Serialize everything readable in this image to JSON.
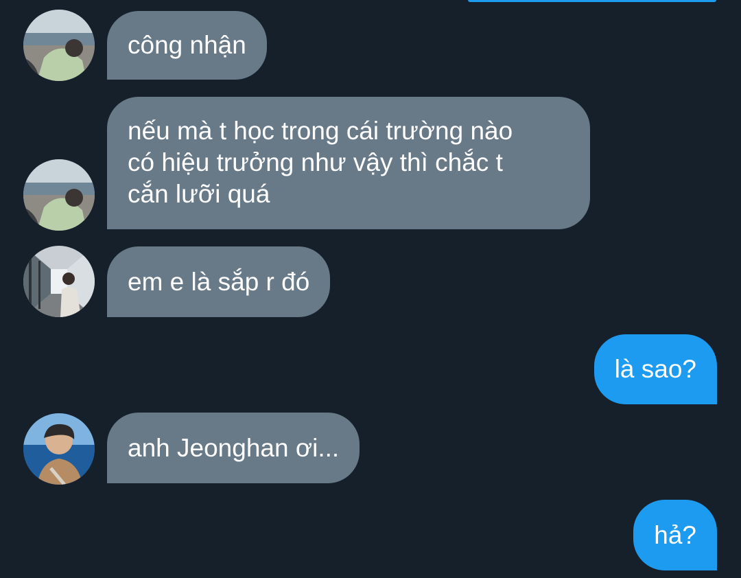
{
  "conversation": {
    "messages": [
      {
        "direction": "incoming",
        "sender_avatar": "beach-avatar",
        "lines": [
          "công nhận"
        ]
      },
      {
        "direction": "incoming",
        "sender_avatar": "beach-avatar",
        "lines": [
          "nếu mà t học trong cái trường nào",
          "có hiệu trưởng như vậy thì chắc t",
          "cắn lưỡi quá"
        ]
      },
      {
        "direction": "incoming",
        "sender_avatar": "corridor-avatar",
        "lines": [
          "em e là sắp r đó"
        ]
      },
      {
        "direction": "outgoing",
        "lines": [
          "là sao?"
        ]
      },
      {
        "direction": "incoming",
        "sender_avatar": "ocean-avatar",
        "lines": [
          "anh Jeonghan ơi..."
        ]
      },
      {
        "direction": "outgoing",
        "lines": [
          "hả?"
        ]
      }
    ]
  },
  "colors": {
    "background": "#15202b",
    "incoming_bubble": "#687988",
    "outgoing_bubble": "#1d9bf0",
    "text": "#ffffff"
  }
}
